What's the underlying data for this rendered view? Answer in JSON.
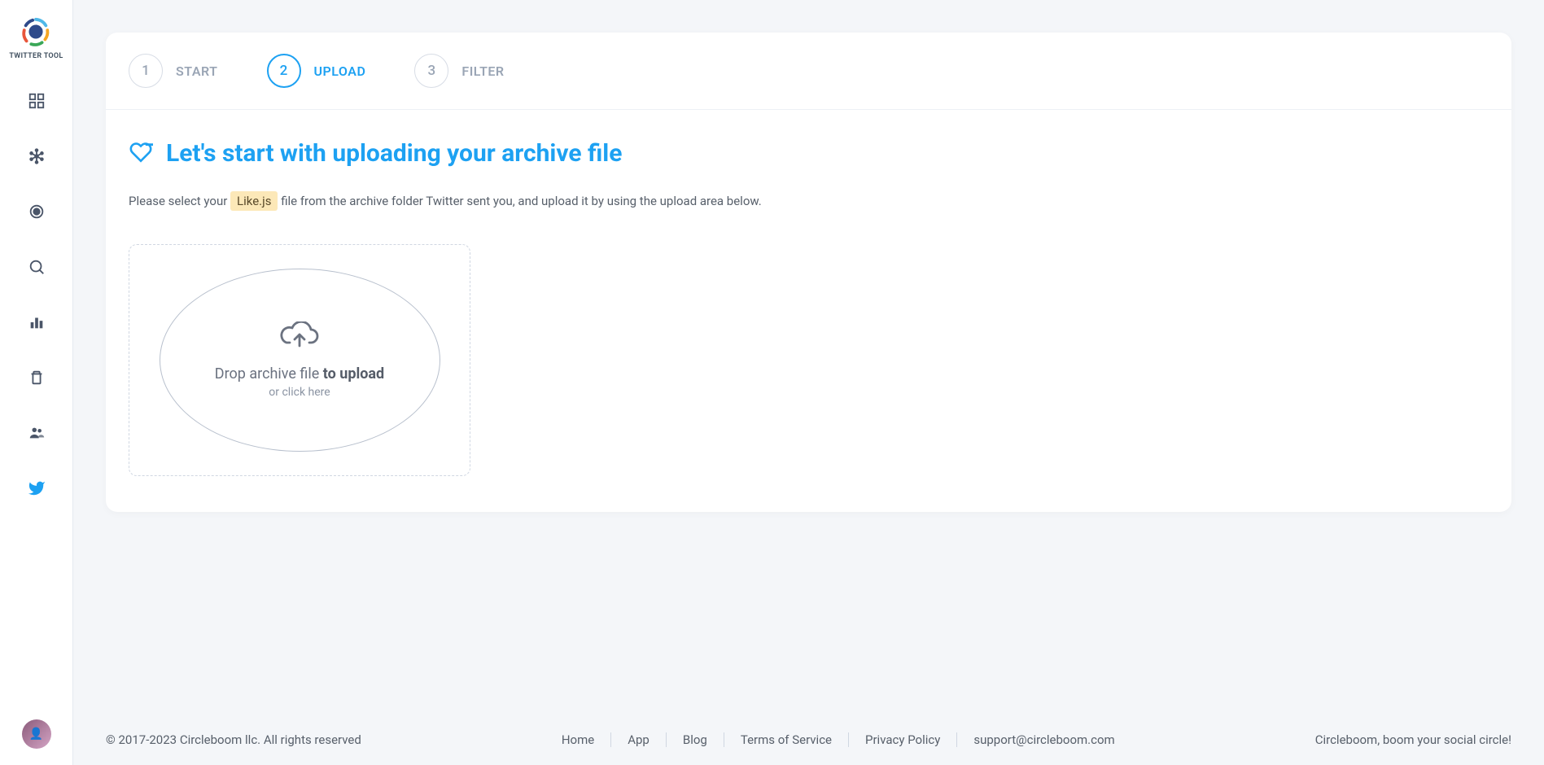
{
  "sidebar": {
    "logo_label": "TWITTER TOOL"
  },
  "stepper": {
    "steps": [
      {
        "num": "1",
        "label": "START"
      },
      {
        "num": "2",
        "label": "UPLOAD"
      },
      {
        "num": "3",
        "label": "FILTER"
      }
    ]
  },
  "content": {
    "title": "Let's start with uploading your archive file",
    "instruction_pre": "Please select your ",
    "instruction_file": "Like.js",
    "instruction_post": " file from the archive folder Twitter sent you, and upload it by using the upload area below.",
    "upload_main_pre": "Drop archive file ",
    "upload_main_bold": "to upload",
    "upload_sub": "or click here"
  },
  "footer": {
    "copyright": "© 2017-2023 Circleboom llc. All rights reserved",
    "links": [
      "Home",
      "App",
      "Blog",
      "Terms of Service",
      "Privacy Policy",
      "support@circleboom.com"
    ],
    "tagline": "Circleboom, boom your social circle!"
  }
}
